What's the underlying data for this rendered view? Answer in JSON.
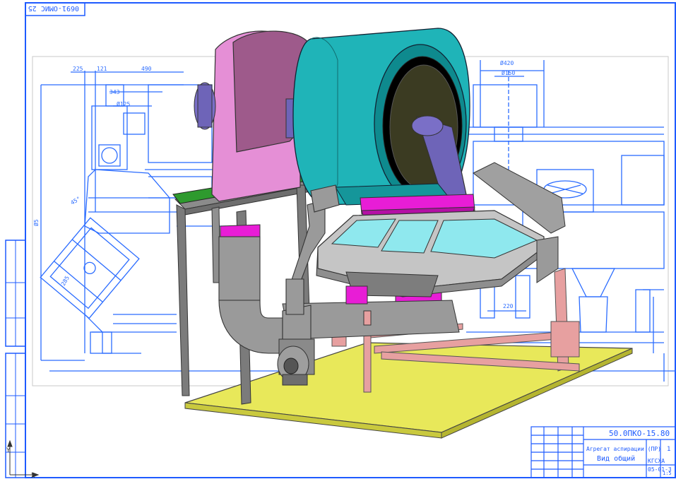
{
  "sheet": {
    "corner_code": "0691-ОМИС 25",
    "side_strip": [
      "",
      "",
      "",
      "",
      ""
    ]
  },
  "dimensions": {
    "top": [
      "225",
      "121",
      "490"
    ],
    "left": [
      "343",
      "Ø125"
    ],
    "right": [
      "Ø420",
      "Ø150"
    ],
    "bottom": [
      "220"
    ],
    "vertical": [
      "Ø5",
      "285"
    ],
    "angle": "45°"
  },
  "title_block": {
    "doc_code": "50.0ПКО-15.80",
    "title_line1": "Агрегат аспирации (ПР)",
    "title_line2": "Вид общий",
    "org_line1": "КГСХА",
    "org_line2": "05-01-3",
    "sheet_no": "1",
    "scale_note": "1:5"
  },
  "axes": {
    "y": "Y",
    "x": "X"
  },
  "palette": {
    "frame": "#1e5bff",
    "drawing_blue": "#2b6cff",
    "drum_cyan": "#1fb4b8",
    "fan_pink": "#e58fd6",
    "base_yellow": "#e8e85a",
    "frame_grey": "#808080",
    "magenta": "#e81dd6",
    "glass": "#8fe8ee"
  }
}
